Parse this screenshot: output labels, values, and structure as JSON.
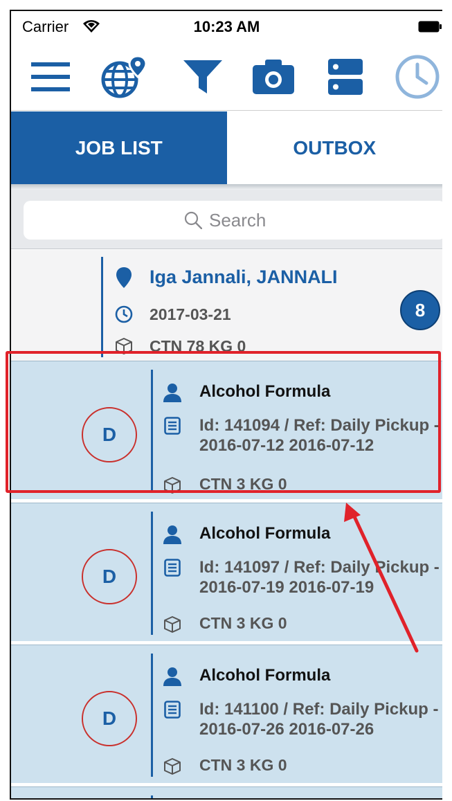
{
  "status_bar": {
    "carrier": "Carrier",
    "time": "10:23 AM"
  },
  "toolbar": {
    "icons": [
      "menu-icon",
      "globe-location-icon",
      "filter-icon",
      "camera-icon",
      "server-icon",
      "clock-icon"
    ]
  },
  "tabs": [
    {
      "label": "JOB LIST",
      "active": true
    },
    {
      "label": "OUTBOX",
      "active": false
    }
  ],
  "search": {
    "placeholder": "Search"
  },
  "location": {
    "name": "Iga Jannali, JANNALI",
    "date": "2017-03-21",
    "quantity": "CTN 78 KG 0",
    "job_count": "8"
  },
  "jobs": [
    {
      "status": "D",
      "customer": "Alcohol Formula",
      "reference": "Id: 141094 / Ref: Daily Pickup - 2016-07-12 2016-07-12",
      "quantity": "CTN 3 KG 0"
    },
    {
      "status": "D",
      "customer": "Alcohol Formula",
      "reference": "Id: 141097 / Ref: Daily Pickup - 2016-07-19 2016-07-19",
      "quantity": "CTN 3 KG 0"
    },
    {
      "status": "D",
      "customer": "Alcohol Formula",
      "reference": "Id: 141100 / Ref: Daily Pickup - 2016-07-26 2016-07-26",
      "quantity": "CTN 3 KG 0"
    }
  ],
  "colors": {
    "primary": "#1b5fa5",
    "item_background": "#cde1ee",
    "status_ring": "#c9302c",
    "annotation": "#e0222a"
  }
}
